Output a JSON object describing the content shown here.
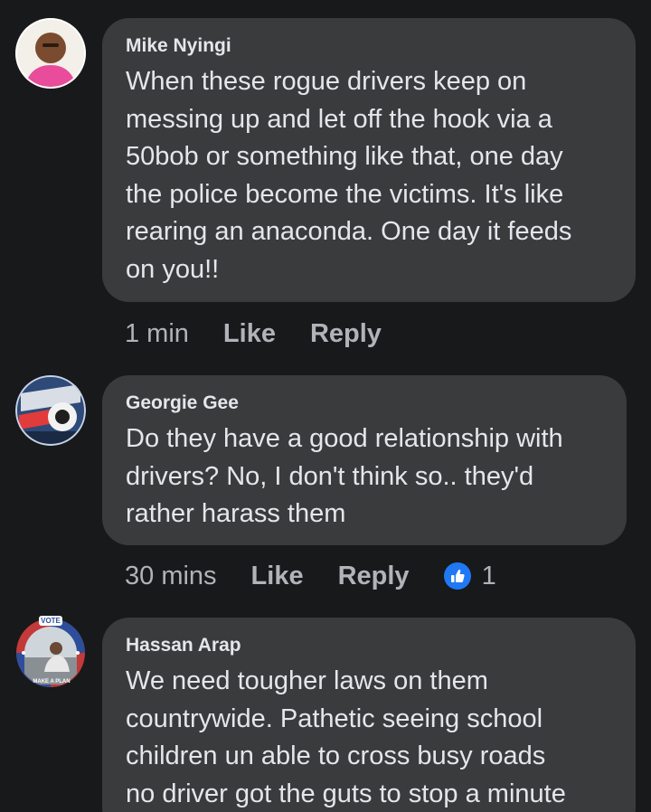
{
  "comments": [
    {
      "author": "Mike Nyingi",
      "text": "When these rogue drivers keep on\nmessing up and let off the hook via a\n50bob or something like that, one day\nthe police become the victims. It's like\nrearing an anaconda. One day it feeds\non you!!",
      "time": "1 min",
      "like_label": "Like",
      "reply_label": "Reply"
    },
    {
      "author": "Georgie Gee",
      "text": "Do they have a good relationship with\ndrivers? No, I don't think so.. they'd\nrather harass them",
      "time": "30 mins",
      "like_label": "Like",
      "reply_label": "Reply",
      "reaction_count": "1"
    },
    {
      "author": "Hassan Arap",
      "text": "We need tougher laws on them\ncountrywide. Pathetic seeing school\nchildren un able to cross busy roads\nno driver got the guts to stop a minute",
      "avatar_badge_top": "VOTE",
      "avatar_badge_bottom": "MAKE A PLAN"
    }
  ],
  "colors": {
    "background": "#18191a",
    "bubble": "#3a3b3c",
    "text_primary": "#e4e6eb",
    "text_secondary": "#b0b3b8",
    "like_blue": "#2078f4"
  }
}
